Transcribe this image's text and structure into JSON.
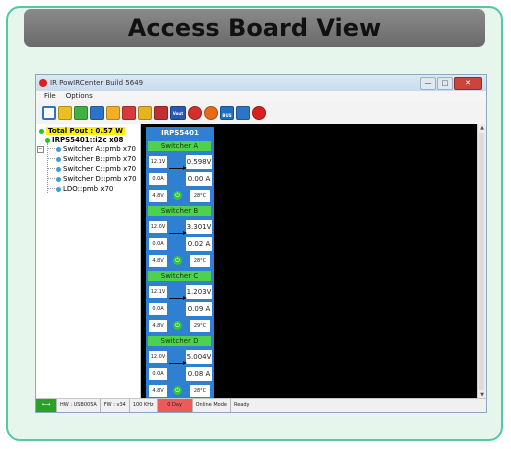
{
  "banner": {
    "title": "Access Board View"
  },
  "window": {
    "title": "IR PowIRCenter Build 5649",
    "min_label": "—",
    "max_label": "□",
    "close_label": "✕"
  },
  "menu": [
    "File",
    "Options"
  ],
  "toolbar": {
    "icons": [
      {
        "name": "select-icon",
        "color": "#2c74c9"
      },
      {
        "name": "grid-icon",
        "color": "#e8c020"
      },
      {
        "name": "chip-icon",
        "color": "#40b040"
      },
      {
        "name": "document-icon",
        "color": "#2c74c9"
      },
      {
        "name": "folder-icon",
        "color": "#f2b027"
      },
      {
        "name": "save-icon",
        "color": "#d63a3a"
      },
      {
        "name": "vout-icon",
        "color": "#e8b320"
      },
      {
        "name": "waveform-icon",
        "color": "#c03030"
      },
      {
        "name": "vout-meter-icon",
        "color": "#2a57b5"
      },
      {
        "name": "warning-icon",
        "color": "#d32f2f"
      },
      {
        "name": "fire-icon",
        "color": "#e56a19"
      },
      {
        "name": "i2c-bus-icon",
        "color": "#1f6fbf"
      },
      {
        "name": "pmbus-icon",
        "color": "#2c74c9"
      },
      {
        "name": "help-icon",
        "color": "#d91f1f"
      }
    ],
    "icon_labels": {
      "vout": "Vout",
      "i2c_bus": "BUS"
    }
  },
  "tree": {
    "total": "Total Pout : 0.57 W",
    "device": "IRPS5401::i2c x08",
    "items": [
      "Switcher A::pmb x70",
      "Switcher B::pmb x70",
      "Switcher C::pmb x70",
      "Switcher D::pmb x70",
      "LDO::pmb x70"
    ]
  },
  "panel": {
    "title": "IRPS5401",
    "switchers": [
      {
        "name": "Switcher A",
        "vin": "12.1V",
        "vout": "0.598V",
        "iin": "0.0A",
        "iout": "0.00 A",
        "vaux": "4.8V",
        "temp": "28°C"
      },
      {
        "name": "Switcher B",
        "vin": "12.0V",
        "vout": "3.301V",
        "iin": "0.0A",
        "iout": "0.02 A",
        "vaux": "4.8V",
        "temp": "28°C"
      },
      {
        "name": "Switcher C",
        "vin": "12.1V",
        "vout": "1.203V",
        "iin": "0.0A",
        "iout": "0.09 A",
        "vaux": "4.8V",
        "temp": "29°C"
      },
      {
        "name": "Switcher D",
        "vin": "12.0V",
        "vout": "5.004V",
        "iin": "0.0A",
        "iout": "0.08 A",
        "vaux": "4.8V",
        "temp": "28°C"
      }
    ]
  },
  "status": {
    "usb": "⟷",
    "hw": "HW : USB005A",
    "fw": "FW : v34",
    "speed": "100 KHz",
    "day": "0 Day",
    "mode": "Online Mode",
    "state": "Ready"
  }
}
